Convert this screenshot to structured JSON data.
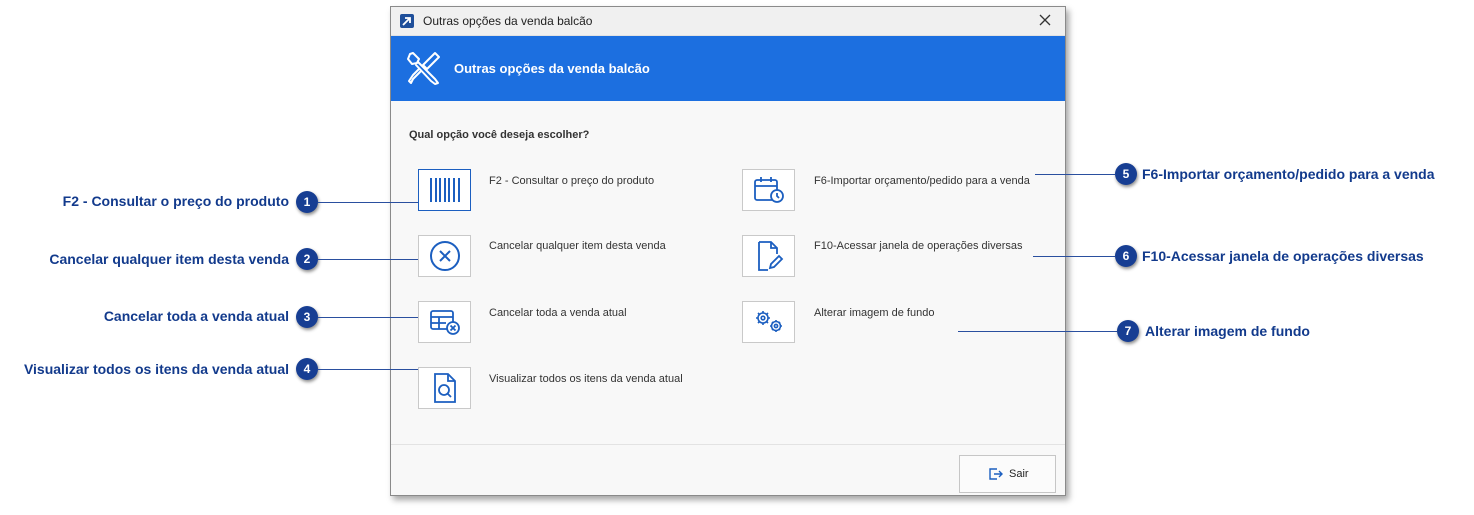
{
  "window": {
    "title": "Outras opções da venda balcão"
  },
  "banner": {
    "title": "Outras opções da venda balcão",
    "icon": "tools-icon",
    "color": "#1c6fe0"
  },
  "question": "Qual opção você deseja escolher?",
  "options": [
    {
      "label": "F2 - Consultar o preço do produto",
      "icon": "barcode-icon"
    },
    {
      "label": "Cancelar qualquer item desta venda",
      "icon": "cancel-circle-icon"
    },
    {
      "label": "Cancelar toda a venda atual",
      "icon": "cancel-sale-icon"
    },
    {
      "label": "Visualizar todos os itens da venda atual",
      "icon": "document-search-icon"
    },
    {
      "label": "F6-Importar orçamento/pedido para a venda",
      "icon": "calendar-clock-icon"
    },
    {
      "label": "F10-Acessar janela de operações diversas",
      "icon": "document-edit-icon"
    },
    {
      "label": "Alterar imagem de fundo",
      "icon": "gears-icon"
    }
  ],
  "footer": {
    "exit_label": "Sair",
    "exit_icon": "exit-icon"
  },
  "callouts": [
    {
      "number": "1",
      "text": "F2 - Consultar o preço do produto"
    },
    {
      "number": "2",
      "text": "Cancelar qualquer item desta venda"
    },
    {
      "number": "3",
      "text": "Cancelar toda a venda atual"
    },
    {
      "number": "4",
      "text": "Visualizar todos os itens da venda atual"
    },
    {
      "number": "5",
      "text": "F6-Importar orçamento/pedido para a venda"
    },
    {
      "number": "6",
      "text": "F10-Acessar janela de operações diversas"
    },
    {
      "number": "7",
      "text": "Alterar imagem de fundo"
    }
  ],
  "colors": {
    "callout": "#123a8c",
    "badge": "#173e93",
    "icon": "#1c5fc0"
  }
}
